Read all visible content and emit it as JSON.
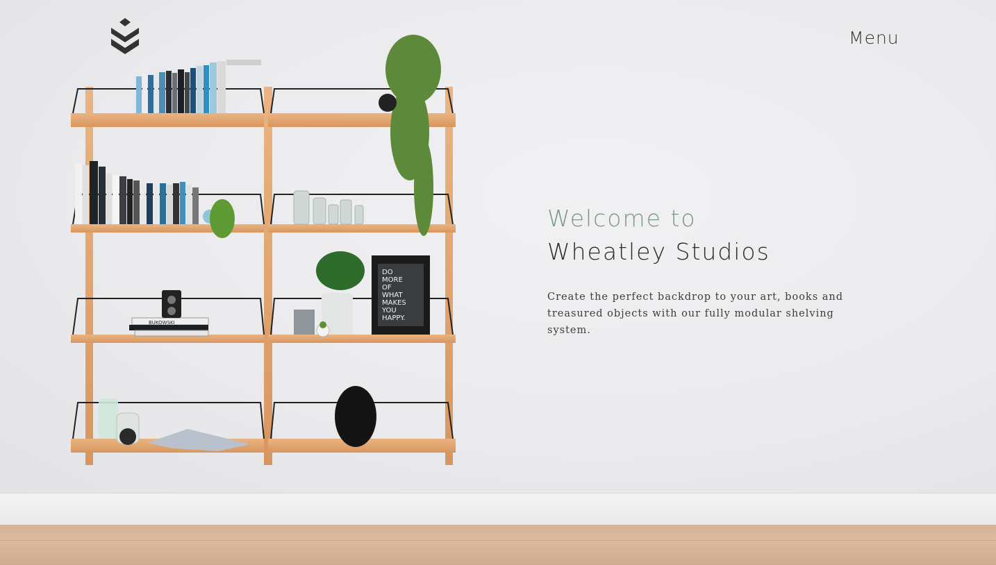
{
  "header": {
    "logo_icon": "stacked-chevrons-logo",
    "menu_label": "Menu"
  },
  "hero": {
    "welcome": "Welcome to",
    "studio_name": "Wheatley Studios",
    "description": "Create the perfect backdrop to your art, books and treasured objects with our fully modular shelving system."
  },
  "artwork": {
    "poster_text": [
      "DO",
      "MORE",
      "OF",
      "WHAT",
      "MAKES",
      "YOU",
      "HAPPY."
    ],
    "book_spine": "BUKOWSKI"
  },
  "colors": {
    "accent": "#7a9684",
    "text_dark": "#2b2b2b",
    "wood": "#e2a776"
  }
}
